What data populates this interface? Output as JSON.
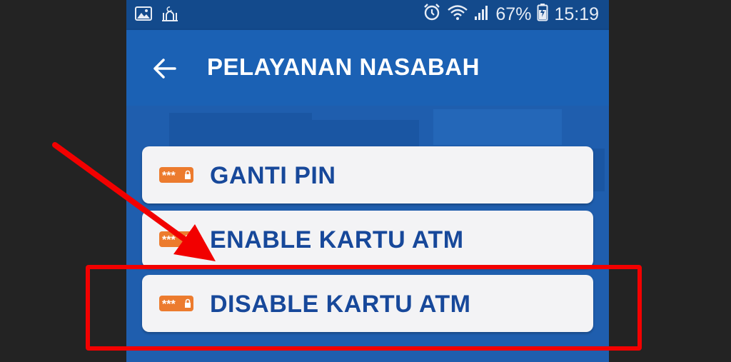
{
  "status_bar": {
    "left_icons": [
      "image-icon",
      "mosque-icon"
    ],
    "battery_percent": "67%",
    "time": "15:19"
  },
  "app_bar": {
    "title": "PELAYANAN NASABAH",
    "back_icon": "back-arrow-icon"
  },
  "menu": {
    "items": [
      {
        "label": "GANTI PIN",
        "icon": "pin-lock-icon"
      },
      {
        "label": "ENABLE KARTU ATM",
        "icon": "pin-lock-icon"
      },
      {
        "label": "DISABLE KARTU ATM",
        "icon": "pin-lock-icon"
      }
    ]
  },
  "annotation": {
    "highlighted_item": "DISABLE KARTU ATM",
    "color": "#f20000"
  },
  "colors": {
    "app_bar": "#1b61b4",
    "status_bar": "#134a8c",
    "menu_text": "#17489a",
    "pin_icon": "#ec7b2e"
  }
}
